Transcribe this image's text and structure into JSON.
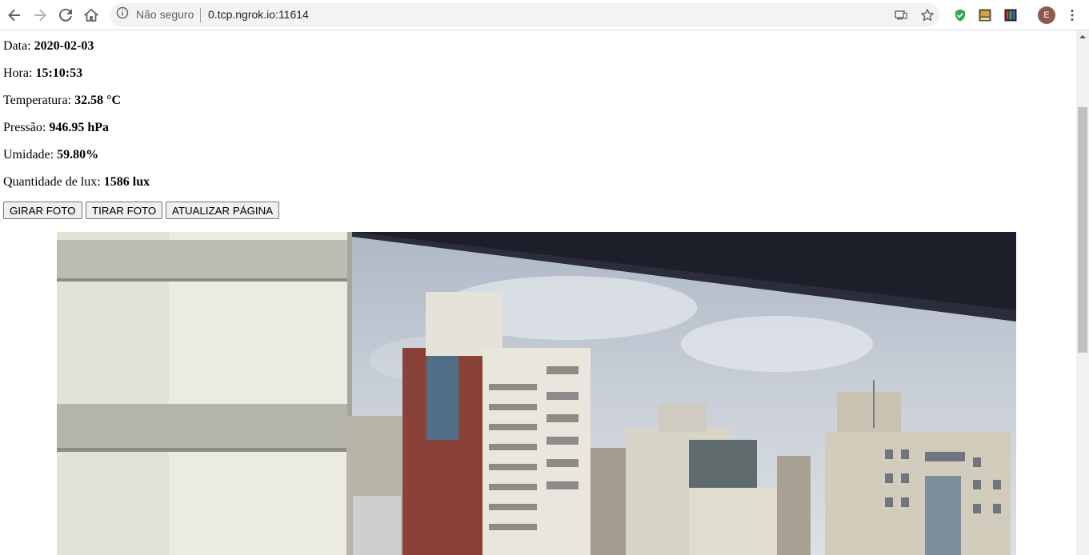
{
  "browser": {
    "security_label": "Não seguro",
    "url": "0.tcp.ngrok.io:11614",
    "avatar_initial": "E"
  },
  "readings": [
    {
      "label": "Data: ",
      "value": "2020-02-03"
    },
    {
      "label": "Hora: ",
      "value": "15:10:53"
    },
    {
      "label": "Temperatura: ",
      "value": "32.58 °C"
    },
    {
      "label": "Pressão: ",
      "value": "946.95 hPa"
    },
    {
      "label": "Umidade: ",
      "value": "59.80%"
    },
    {
      "label": "Quantidade de lux: ",
      "value": "1586 lux"
    }
  ],
  "buttons": {
    "rotate": "GIRAR FOTO",
    "capture": "TIRAR FOTO",
    "refresh": "ATUALIZAR PÁGINA"
  },
  "icons": [
    "back-icon",
    "forward-icon",
    "reload-icon",
    "home-icon",
    "info-icon",
    "cast-icon",
    "star-icon",
    "shield-extension-icon",
    "extension-icon",
    "media-extension-icon",
    "menu-icon"
  ]
}
